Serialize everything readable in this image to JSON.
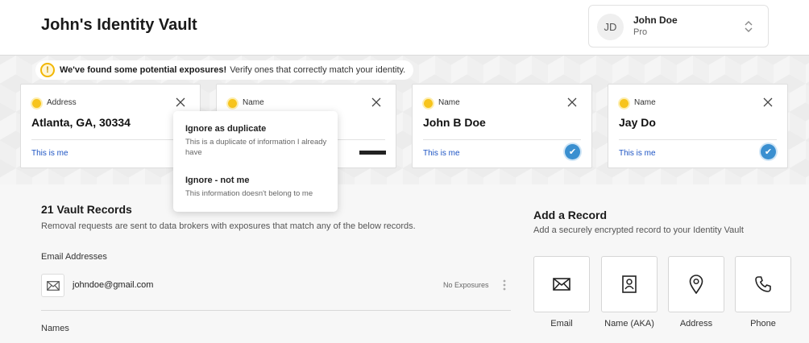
{
  "header": {
    "title": "John's Identity Vault",
    "user": {
      "initials": "JD",
      "name": "John Doe",
      "plan": "Pro"
    }
  },
  "alert": {
    "icon": "exclamation-icon",
    "strong": "We've found some potential exposures!",
    "text": "Verify ones that correctly match your identity."
  },
  "exposures": [
    {
      "type": "Address",
      "value": "Atlanta, GA, 30334",
      "link": "This is me",
      "verified": false
    },
    {
      "type": "Name",
      "value": "",
      "link": "",
      "verified": false
    },
    {
      "type": "Name",
      "value": "John B Doe",
      "link": "This is me",
      "verified": true
    },
    {
      "type": "Name",
      "value": "Jay Do",
      "link": "This is me",
      "verified": true
    }
  ],
  "menu": [
    {
      "title": "Ignore as duplicate",
      "desc": "This is a duplicate of information I already have"
    },
    {
      "title": "Ignore - not me",
      "desc": "This information doesn't belong to me"
    }
  ],
  "records": {
    "title": "21 Vault Records",
    "subtitle": "Removal requests are sent to data brokers with exposures that match any of the below records.",
    "email_section": "Email Addresses",
    "email": "johndoe@gmail.com",
    "email_status": "No Exposures",
    "names_section": "Names"
  },
  "add_record": {
    "title": "Add a Record",
    "subtitle": "Add a securely encrypted record to your Identity Vault",
    "tiles": [
      {
        "label": "Email",
        "icon": "envelope-icon"
      },
      {
        "label": "Name (AKA)",
        "icon": "id-card-icon"
      },
      {
        "label": "Address",
        "icon": "map-pin-icon"
      },
      {
        "label": "Phone",
        "icon": "phone-icon"
      }
    ]
  },
  "colors": {
    "accent_blue": "#1d54c4",
    "warning_yellow": "#f7c41c",
    "check_blue": "#3a8fd0"
  }
}
